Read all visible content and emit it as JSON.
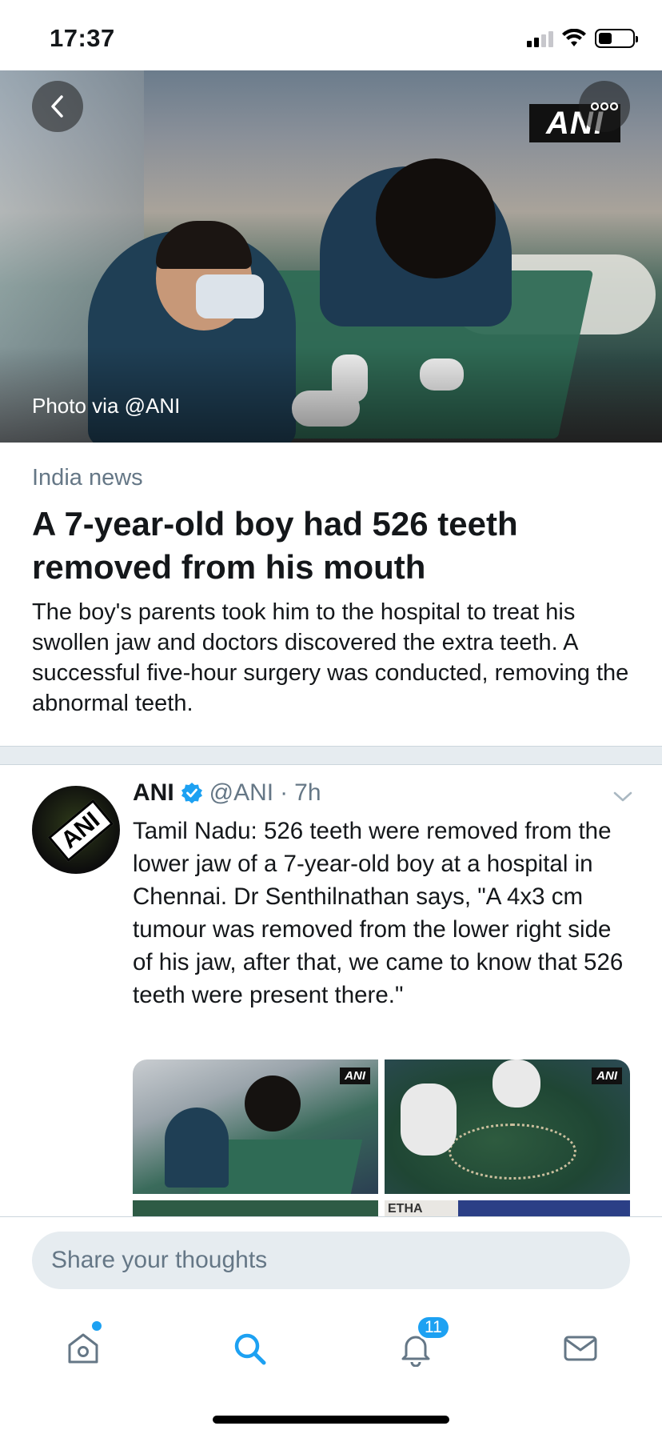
{
  "status_bar": {
    "time": "17:37"
  },
  "hero": {
    "photo_credit": "Photo via @ANI",
    "logo_text": "ANI"
  },
  "article": {
    "category": "India news",
    "headline": "A 7-year-old boy had 526 teeth removed from his mouth",
    "summary": "The boy's parents took him to the hospital to treat his swollen jaw and doctors discovered the extra teeth. A successful five-hour surgery was conducted, removing the abnormal teeth."
  },
  "tweet": {
    "avatar_text": "ANI",
    "name": "ANI",
    "handle": "@ANI",
    "separator": "·",
    "time": "7h",
    "text": "Tamil Nadu: 526 teeth were removed from the lower jaw of a 7-year-old boy at a hospital in Chennai. Dr Senthilnathan says, \"A 4x3 cm tumour was removed from the lower right side of his jaw, after that, we came to know that 526 teeth were present there.\"",
    "media_watermark": "ANI",
    "media_partial_text": "ETHA"
  },
  "compose": {
    "placeholder": "Share your thoughts"
  },
  "tabbar": {
    "notifications_count": "11",
    "accent": "#1da1f2"
  },
  "icons": {
    "back": "chevron-left-icon",
    "more": "more-dots-icon",
    "verified": "verified-badge-icon",
    "caret": "chevron-down-icon",
    "home": "home-icon",
    "search": "search-icon",
    "notifications": "bell-icon",
    "messages": "mail-icon"
  }
}
